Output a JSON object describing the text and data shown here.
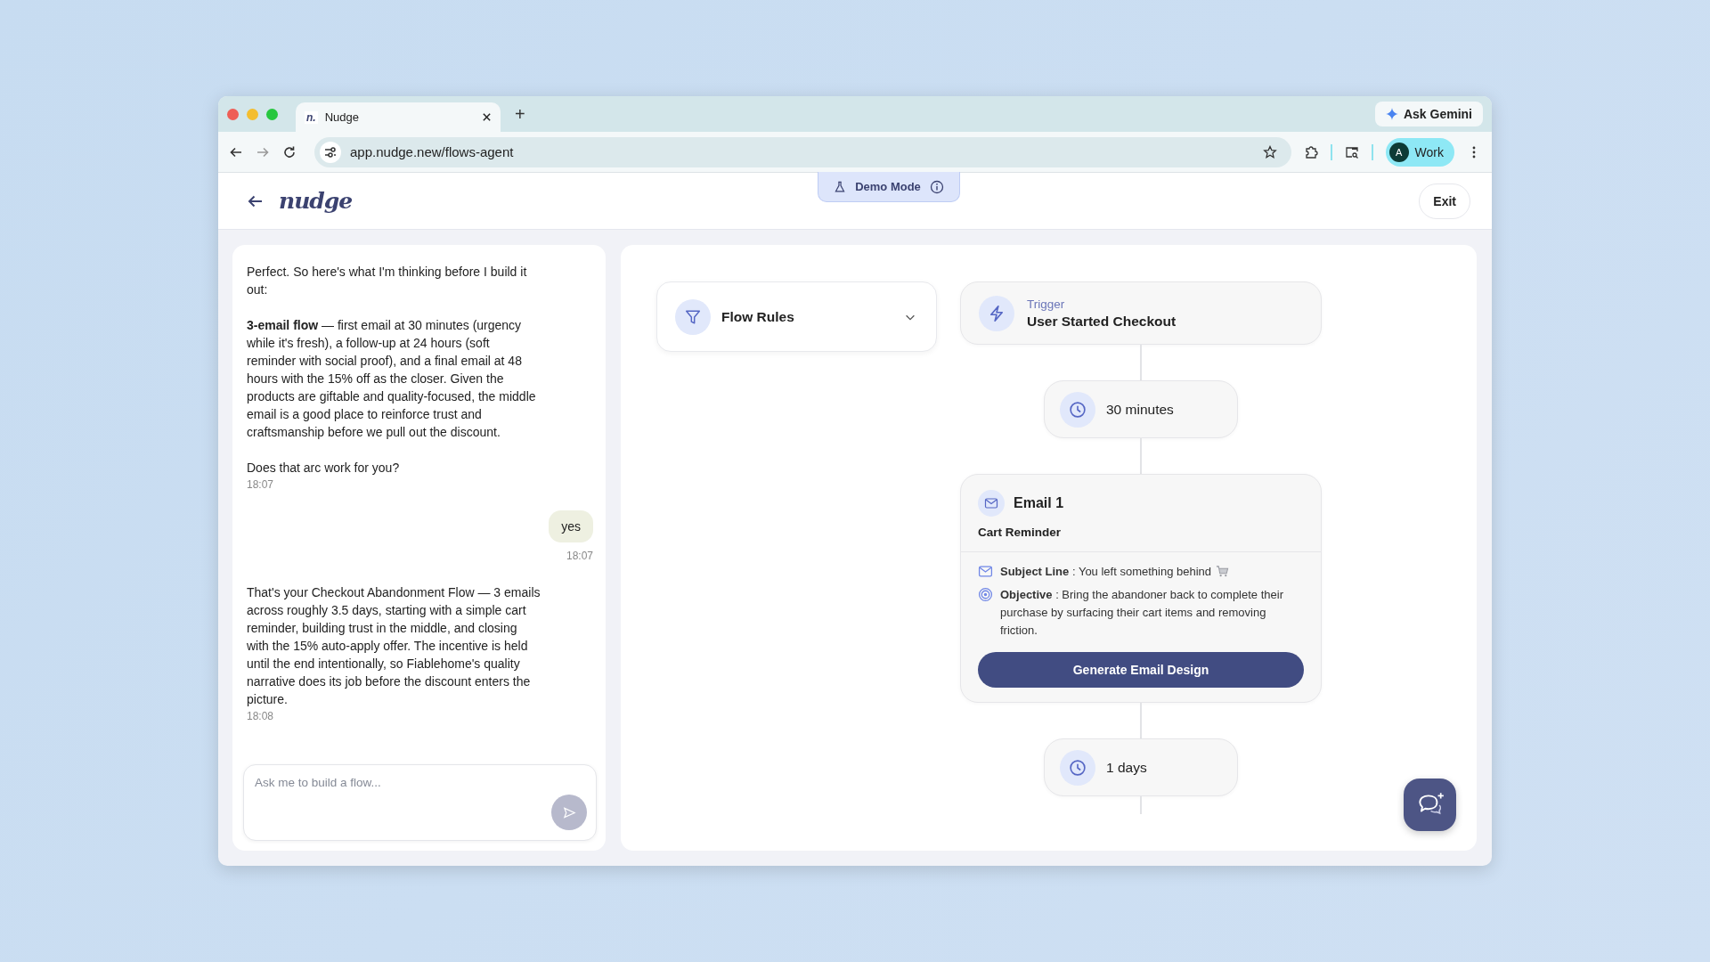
{
  "browser": {
    "tab": {
      "favicon": "n.",
      "title": "Nudge"
    },
    "new_tab": "+",
    "ask_gemini": "Ask Gemini",
    "address": "app.nudge.new/flows-agent",
    "profile": {
      "initial": "A",
      "label": "Work"
    }
  },
  "header": {
    "logo": "nudge",
    "demo_mode": "Demo Mode",
    "exit": "Exit"
  },
  "chat": {
    "messages": [
      {
        "kind": "assistant",
        "paragraphs": [
          " Perfect. So here's what I'm thinking before I build it out:",
          "**3-email flow** — first email at 30 minutes (urgency while it's fresh), a follow-up at 24 hours (soft reminder with social proof), and a final email at 48 hours with the 15% off as the closer. Given the products are giftable and quality-focused, the middle email is a good place to reinforce trust and craftsmanship before we pull out the discount.",
          "Does that arc work for you?"
        ],
        "time": "18:07"
      },
      {
        "kind": "user",
        "text": "yes",
        "time": "18:07"
      },
      {
        "kind": "assistant",
        "paragraphs": [
          "That's your Checkout Abandonment Flow — 3 emails across roughly 3.5 days, starting with a simple cart reminder, building trust in the middle, and closing with the 15% auto-apply offer. The incentive is held until the end intentionally, so Fiablehome's quality narrative does its job before the discount enters the picture."
        ],
        "time": "18:08"
      }
    ],
    "input": {
      "placeholder": "Ask me to build a flow..."
    }
  },
  "flow_rules": {
    "label": "Flow Rules"
  },
  "flow": [
    {
      "kind": "trigger",
      "label": "Trigger",
      "title": "User Started Checkout"
    },
    {
      "kind": "delay",
      "text": "30 minutes"
    },
    {
      "kind": "email",
      "title": "Email 1",
      "subtitle": "Cart Reminder",
      "details": [
        {
          "kind": "subject",
          "text": "**Subject Line** : You left something behind"
        },
        {
          "kind": "objective",
          "text": "**Objective** : Bring the abandoner back to complete their purchase by surfacing their cart items and removing friction."
        }
      ],
      "button": "Generate Email Design"
    },
    {
      "kind": "delay",
      "text": "1 days"
    }
  ]
}
